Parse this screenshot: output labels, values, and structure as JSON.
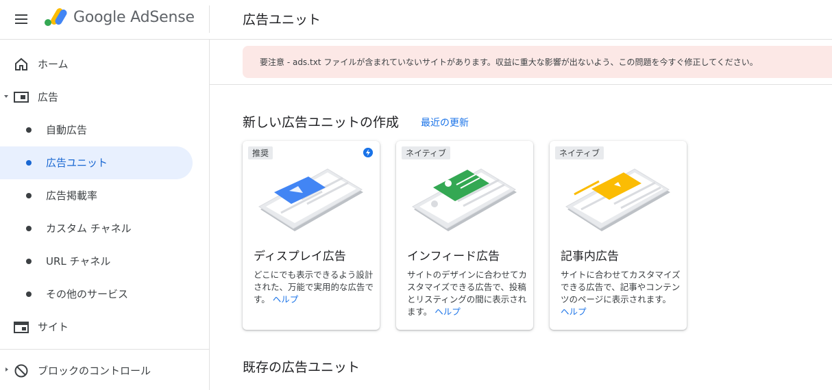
{
  "header": {
    "brand": "Google AdSense",
    "page_title": "広告ユニット"
  },
  "sidebar": {
    "items": [
      {
        "label": "ホーム"
      },
      {
        "label": "広告"
      },
      {
        "label": "自動広告"
      },
      {
        "label": "広告ユニット"
      },
      {
        "label": "広告掲載率"
      },
      {
        "label": "カスタム チャネル"
      },
      {
        "label": "URL チャネル"
      },
      {
        "label": "その他のサービス"
      },
      {
        "label": "サイト"
      },
      {
        "label": "ブロックのコントロール"
      }
    ]
  },
  "alert": {
    "text": "要注意 - ads.txt ファイルが含まれていないサイトがあります。収益に重大な影響が出ないよう、この問題を今すぐ修正してください。"
  },
  "create_section": {
    "title": "新しい広告ユニットの作成",
    "recent_link": "最近の更新"
  },
  "cards": [
    {
      "badge": "推奨",
      "title": "ディスプレイ広告",
      "desc": "どこにでも表示できるよう設計された、万能で実用的な広告です。",
      "help": "ヘルプ",
      "accent": "#4285f4"
    },
    {
      "badge": "ネイティブ",
      "title": "インフィード広告",
      "desc": "サイトのデザインに合わせてカスタマイズできる広告で、投稿とリスティングの間に表示されます。",
      "help": "ヘルプ",
      "accent": "#34a853"
    },
    {
      "badge": "ネイティブ",
      "title": "記事内広告",
      "desc": "サイトに合わせてカスタマイズできる広告で、記事やコンテンツのページに表示されます。",
      "help": "ヘルプ",
      "accent": "#fbbc04"
    }
  ],
  "existing_section": {
    "title": "既存の広告ユニット"
  },
  "colors": {
    "accent_blue": "#1a73e8",
    "active_bg": "#e8f0fe",
    "alert_bg": "#fce8e6"
  }
}
